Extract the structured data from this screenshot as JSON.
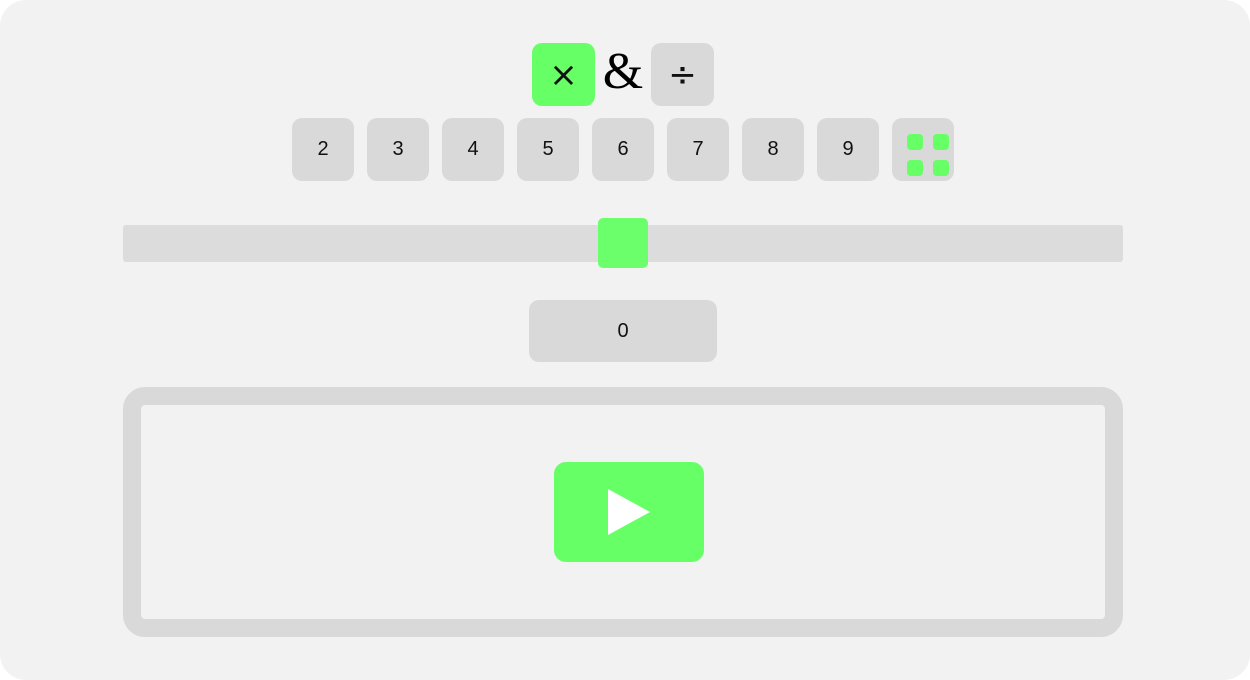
{
  "operations": {
    "multiply": {
      "label": "×",
      "icon": "multiply-icon",
      "selected": true
    },
    "connector": "&",
    "divide": {
      "label": "÷",
      "icon": "divide-icon",
      "selected": false
    }
  },
  "tables": {
    "numbers": [
      "2",
      "3",
      "4",
      "5",
      "6",
      "7",
      "8",
      "9"
    ],
    "all_icon": "grid-icon"
  },
  "slider": {
    "level_percent": 50
  },
  "value_display": "0",
  "play": {
    "icon": "play-icon"
  },
  "colors": {
    "accent": "#66ff66",
    "button_bg": "#d9d9d9",
    "panel_bg": "#f2f2f2"
  }
}
